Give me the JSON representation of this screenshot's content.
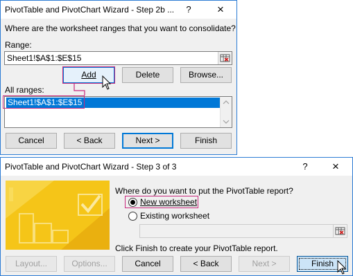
{
  "dialog1": {
    "title": "PivotTable and PivotChart Wizard - Step 2b ...",
    "help_btn": "?",
    "close_btn": "×",
    "question": "Where are the worksheet ranges that you want to consolidate?",
    "range_label": "Range:",
    "range_value": "Sheet1!$A$1:$E$15",
    "add_label": "Add",
    "delete_label": "Delete",
    "browse_label": "Browse...",
    "all_ranges_label": "All ranges:",
    "all_ranges_items": [
      "Sheet1!$A$1:$E$15"
    ],
    "cancel_label": "Cancel",
    "back_label": "< Back",
    "next_label": "Next >",
    "finish_label": "Finish"
  },
  "dialog2": {
    "title": "PivotTable and PivotChart Wizard - Step 3 of 3",
    "help_btn": "?",
    "close_btn": "×",
    "question": "Where do you want to put the PivotTable report?",
    "option_new": "New worksheet",
    "option_existing": "Existing worksheet",
    "selected_option": "New worksheet",
    "existing_value": "",
    "finish_hint": "Click Finish to create your PivotTable report.",
    "layout_label": "Layout...",
    "options_label": "Options...",
    "cancel_label": "Cancel",
    "back_label": "< Back",
    "next_label": "Next >",
    "finish_label": "Finish"
  },
  "colors": {
    "accent": "#0078d7",
    "highlight_frame": "#c8287c",
    "banner_yellow": "#f5c518"
  },
  "icons": [
    "ref-edit-icon",
    "mouse-pointer-icon",
    "pivot-wizard-banner"
  ]
}
